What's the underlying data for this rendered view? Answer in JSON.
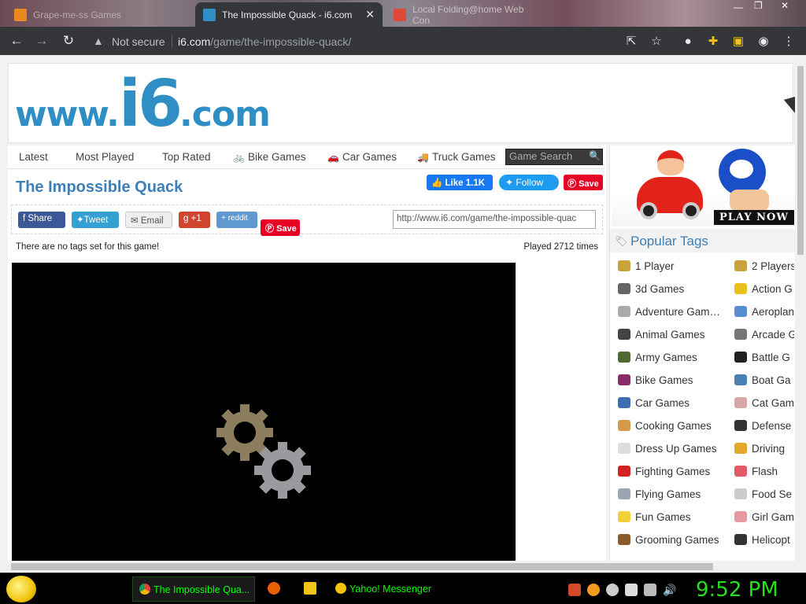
{
  "browser": {
    "tabs": [
      {
        "title": "Grape-me-ss Games",
        "active": false
      },
      {
        "title": "The Impossible Quack - i6.com",
        "active": true
      },
      {
        "title": "Local Folding@home Web Con",
        "active": false
      }
    ],
    "security_label": "Not secure",
    "url_domain": "i6.com",
    "url_path": "/game/the-impossible-quack/"
  },
  "site": {
    "logo_www": "www.",
    "logo_i6": "i6",
    "logo_com": ".com",
    "nav": [
      {
        "label": "Latest"
      },
      {
        "label": "Most Played"
      },
      {
        "label": "Top Rated"
      },
      {
        "label": "Bike Games"
      },
      {
        "label": "Car Games"
      },
      {
        "label": "Truck Games"
      }
    ],
    "search_placeholder": "Game Search"
  },
  "game": {
    "title": "The Impossible Quack",
    "like_label": "Like 1.1K",
    "follow_label": "Follow",
    "save_label": "Save",
    "share": {
      "facebook": "Share",
      "twitter": "Tweet",
      "email": "Email",
      "gplus": "+1",
      "reddit": "reddit",
      "pinterest": "Save"
    },
    "share_url": "http://www.i6.com/game/the-impossible-quac",
    "no_tags_text": "There are no tags set for this game!",
    "played_text": "Played 2712 times"
  },
  "sidebar": {
    "ad_text": "PLAY NOW",
    "popular_tags_title": "Popular Tags",
    "tags_left": [
      {
        "label": "1 Player",
        "color": "#c9a23a"
      },
      {
        "label": "3d Games",
        "color": "#666666"
      },
      {
        "label": "Adventure Gam…",
        "color": "#aaaaaa"
      },
      {
        "label": "Animal Games",
        "color": "#444444"
      },
      {
        "label": "Army Games",
        "color": "#4d6b2f"
      },
      {
        "label": "Bike Games",
        "color": "#8a2b6a"
      },
      {
        "label": "Car Games",
        "color": "#3a6fb0"
      },
      {
        "label": "Cooking Games",
        "color": "#d49a4a"
      },
      {
        "label": "Dress Up Games",
        "color": "#dddddd"
      },
      {
        "label": "Fighting Games",
        "color": "#d22222"
      },
      {
        "label": "Flying Games",
        "color": "#9aa6b4"
      },
      {
        "label": "Fun Games",
        "color": "#f2cf3b"
      },
      {
        "label": "Grooming Games",
        "color": "#8b5a2b"
      }
    ],
    "tags_right": [
      {
        "label": "2 Players",
        "color": "#c9a23a"
      },
      {
        "label": "Action G",
        "color": "#e8c21a"
      },
      {
        "label": "Aeroplan",
        "color": "#5a8fcf"
      },
      {
        "label": "Arcade G",
        "color": "#777777"
      },
      {
        "label": "Battle G",
        "color": "#222222"
      },
      {
        "label": "Boat Ga",
        "color": "#4c7fb3"
      },
      {
        "label": "Cat Gam",
        "color": "#d9a6a6"
      },
      {
        "label": "Defense",
        "color": "#333333"
      },
      {
        "label": "Driving",
        "color": "#e3a82a"
      },
      {
        "label": "Flash",
        "color": "#e05a6a"
      },
      {
        "label": "Food Se",
        "color": "#cccccc"
      },
      {
        "label": "Girl Gam",
        "color": "#e59aa0"
      },
      {
        "label": "Helicopt",
        "color": "#333333"
      }
    ]
  },
  "taskbar": {
    "items": [
      {
        "label": "The Impossible Qua..."
      },
      {
        "label": "Yahoo! Messenger"
      }
    ],
    "clock": "9:52 PM"
  },
  "colors": {
    "brand": "#2f8fc4",
    "title_blue": "#3d7fb6",
    "clock_green": "#26e01e"
  }
}
